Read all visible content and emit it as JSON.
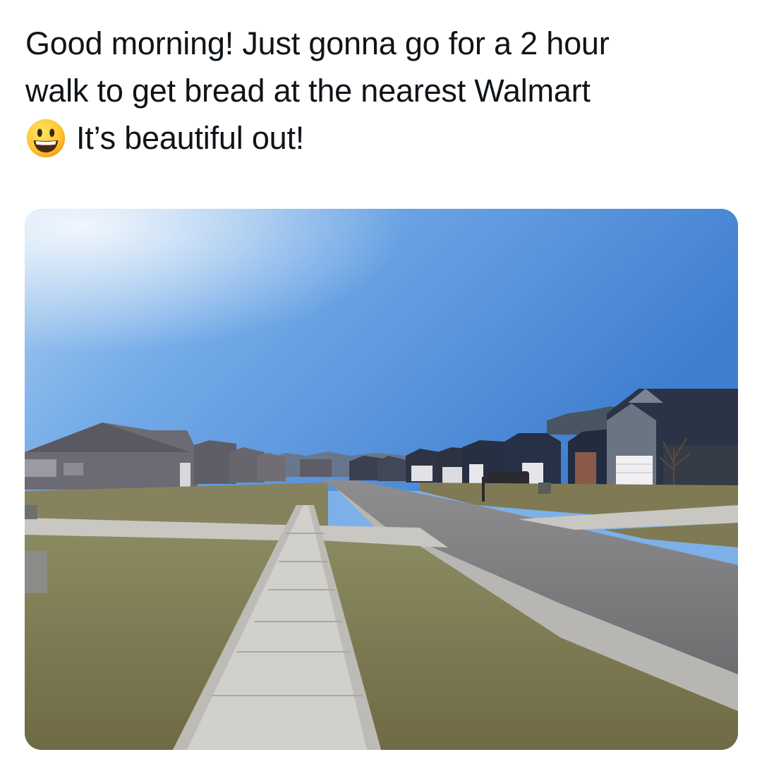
{
  "post": {
    "text_lines": [
      "Good morning! Just gonna go for a 2 hour",
      "walk to get bread at the nearest Walmart",
      "It’s beautiful out!"
    ],
    "emoji": "grinning-face-emoji"
  },
  "media": {
    "kind": "photo",
    "subject": "suburban-street-with-sidewalk-and-houses"
  }
}
